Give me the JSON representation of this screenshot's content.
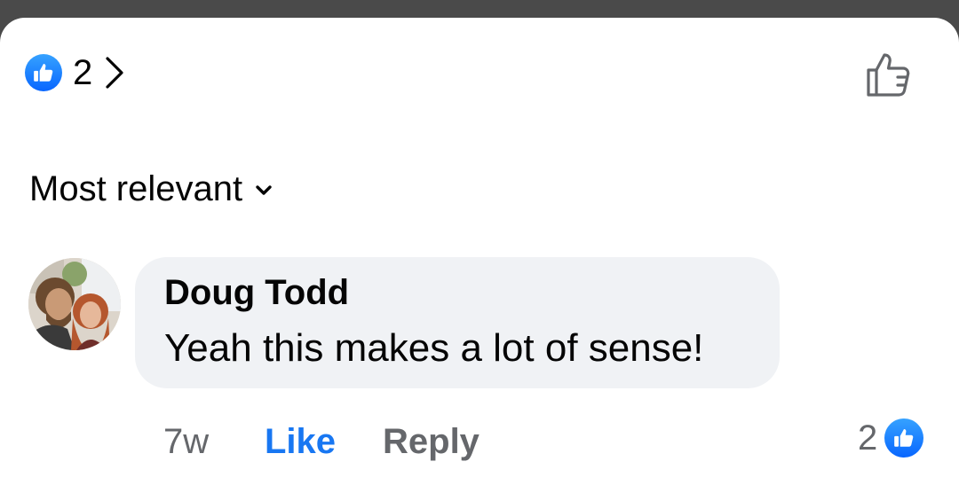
{
  "reactions": {
    "count": "2"
  },
  "sort": {
    "label": "Most relevant"
  },
  "comment": {
    "author": "Doug Todd",
    "text": "Yeah this makes a lot of sense!",
    "time": "7w",
    "like_label": "Like",
    "reply_label": "Reply",
    "reaction_count": "2"
  },
  "colors": {
    "accent": "#1877f2",
    "bubble": "#f0f2f5",
    "secondary_text": "#65676b"
  }
}
